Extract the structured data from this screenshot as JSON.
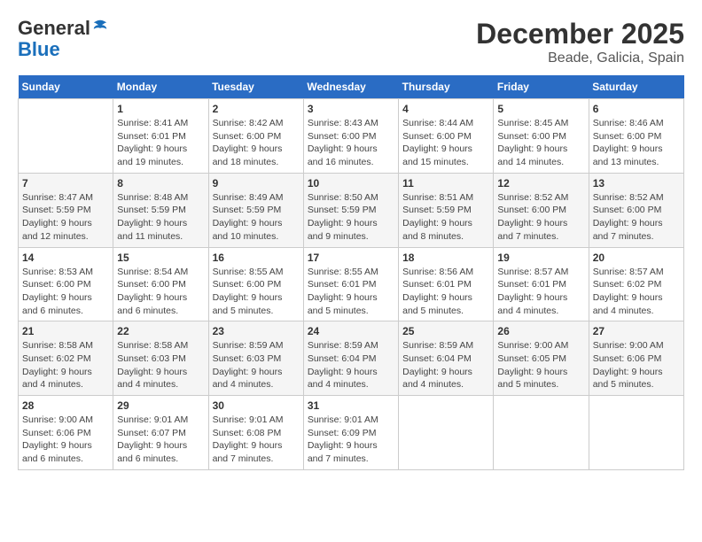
{
  "header": {
    "logo_line1": "General",
    "logo_line2": "Blue",
    "month_year": "December 2025",
    "location": "Beade, Galicia, Spain"
  },
  "weekdays": [
    "Sunday",
    "Monday",
    "Tuesday",
    "Wednesday",
    "Thursday",
    "Friday",
    "Saturday"
  ],
  "weeks": [
    [
      {
        "day": "",
        "info": ""
      },
      {
        "day": "1",
        "info": "Sunrise: 8:41 AM\nSunset: 6:01 PM\nDaylight: 9 hours\nand 19 minutes."
      },
      {
        "day": "2",
        "info": "Sunrise: 8:42 AM\nSunset: 6:00 PM\nDaylight: 9 hours\nand 18 minutes."
      },
      {
        "day": "3",
        "info": "Sunrise: 8:43 AM\nSunset: 6:00 PM\nDaylight: 9 hours\nand 16 minutes."
      },
      {
        "day": "4",
        "info": "Sunrise: 8:44 AM\nSunset: 6:00 PM\nDaylight: 9 hours\nand 15 minutes."
      },
      {
        "day": "5",
        "info": "Sunrise: 8:45 AM\nSunset: 6:00 PM\nDaylight: 9 hours\nand 14 minutes."
      },
      {
        "day": "6",
        "info": "Sunrise: 8:46 AM\nSunset: 6:00 PM\nDaylight: 9 hours\nand 13 minutes."
      }
    ],
    [
      {
        "day": "7",
        "info": "Sunrise: 8:47 AM\nSunset: 5:59 PM\nDaylight: 9 hours\nand 12 minutes."
      },
      {
        "day": "8",
        "info": "Sunrise: 8:48 AM\nSunset: 5:59 PM\nDaylight: 9 hours\nand 11 minutes."
      },
      {
        "day": "9",
        "info": "Sunrise: 8:49 AM\nSunset: 5:59 PM\nDaylight: 9 hours\nand 10 minutes."
      },
      {
        "day": "10",
        "info": "Sunrise: 8:50 AM\nSunset: 5:59 PM\nDaylight: 9 hours\nand 9 minutes."
      },
      {
        "day": "11",
        "info": "Sunrise: 8:51 AM\nSunset: 5:59 PM\nDaylight: 9 hours\nand 8 minutes."
      },
      {
        "day": "12",
        "info": "Sunrise: 8:52 AM\nSunset: 6:00 PM\nDaylight: 9 hours\nand 7 minutes."
      },
      {
        "day": "13",
        "info": "Sunrise: 8:52 AM\nSunset: 6:00 PM\nDaylight: 9 hours\nand 7 minutes."
      }
    ],
    [
      {
        "day": "14",
        "info": "Sunrise: 8:53 AM\nSunset: 6:00 PM\nDaylight: 9 hours\nand 6 minutes."
      },
      {
        "day": "15",
        "info": "Sunrise: 8:54 AM\nSunset: 6:00 PM\nDaylight: 9 hours\nand 6 minutes."
      },
      {
        "day": "16",
        "info": "Sunrise: 8:55 AM\nSunset: 6:00 PM\nDaylight: 9 hours\nand 5 minutes."
      },
      {
        "day": "17",
        "info": "Sunrise: 8:55 AM\nSunset: 6:01 PM\nDaylight: 9 hours\nand 5 minutes."
      },
      {
        "day": "18",
        "info": "Sunrise: 8:56 AM\nSunset: 6:01 PM\nDaylight: 9 hours\nand 5 minutes."
      },
      {
        "day": "19",
        "info": "Sunrise: 8:57 AM\nSunset: 6:01 PM\nDaylight: 9 hours\nand 4 minutes."
      },
      {
        "day": "20",
        "info": "Sunrise: 8:57 AM\nSunset: 6:02 PM\nDaylight: 9 hours\nand 4 minutes."
      }
    ],
    [
      {
        "day": "21",
        "info": "Sunrise: 8:58 AM\nSunset: 6:02 PM\nDaylight: 9 hours\nand 4 minutes."
      },
      {
        "day": "22",
        "info": "Sunrise: 8:58 AM\nSunset: 6:03 PM\nDaylight: 9 hours\nand 4 minutes."
      },
      {
        "day": "23",
        "info": "Sunrise: 8:59 AM\nSunset: 6:03 PM\nDaylight: 9 hours\nand 4 minutes."
      },
      {
        "day": "24",
        "info": "Sunrise: 8:59 AM\nSunset: 6:04 PM\nDaylight: 9 hours\nand 4 minutes."
      },
      {
        "day": "25",
        "info": "Sunrise: 8:59 AM\nSunset: 6:04 PM\nDaylight: 9 hours\nand 4 minutes."
      },
      {
        "day": "26",
        "info": "Sunrise: 9:00 AM\nSunset: 6:05 PM\nDaylight: 9 hours\nand 5 minutes."
      },
      {
        "day": "27",
        "info": "Sunrise: 9:00 AM\nSunset: 6:06 PM\nDaylight: 9 hours\nand 5 minutes."
      }
    ],
    [
      {
        "day": "28",
        "info": "Sunrise: 9:00 AM\nSunset: 6:06 PM\nDaylight: 9 hours\nand 6 minutes."
      },
      {
        "day": "29",
        "info": "Sunrise: 9:01 AM\nSunset: 6:07 PM\nDaylight: 9 hours\nand 6 minutes."
      },
      {
        "day": "30",
        "info": "Sunrise: 9:01 AM\nSunset: 6:08 PM\nDaylight: 9 hours\nand 7 minutes."
      },
      {
        "day": "31",
        "info": "Sunrise: 9:01 AM\nSunset: 6:09 PM\nDaylight: 9 hours\nand 7 minutes."
      },
      {
        "day": "",
        "info": ""
      },
      {
        "day": "",
        "info": ""
      },
      {
        "day": "",
        "info": ""
      }
    ]
  ]
}
